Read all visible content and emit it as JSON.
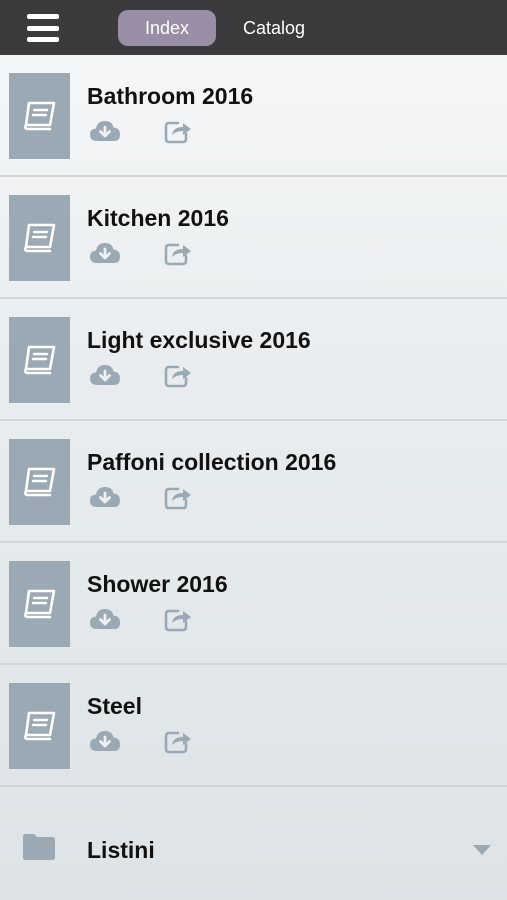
{
  "nav": {
    "menu_icon": "hamburger-menu-icon",
    "tabs": [
      {
        "label": "Index",
        "active": true
      },
      {
        "label": "Catalog",
        "active": false
      }
    ],
    "active_tab_color": "#9a8ea6",
    "bar_color": "#3b3a3c"
  },
  "catalogs": [
    {
      "title": "Bathroom 2016"
    },
    {
      "title": "Kitchen 2016"
    },
    {
      "title": "Light exclusive 2016"
    },
    {
      "title": "Paffoni collection 2016"
    },
    {
      "title": "Shower 2016"
    },
    {
      "title": "Steel"
    }
  ],
  "icons": {
    "thumbnail": "book-icon",
    "download": "cloud-download-icon",
    "share": "share-icon",
    "folder": "folder-icon",
    "expand": "chevron-down-icon"
  },
  "folder": {
    "label": "Listini"
  },
  "colors": {
    "icon_gray": "#9aa9b4",
    "thumb_bg": "#9aa9b4"
  }
}
